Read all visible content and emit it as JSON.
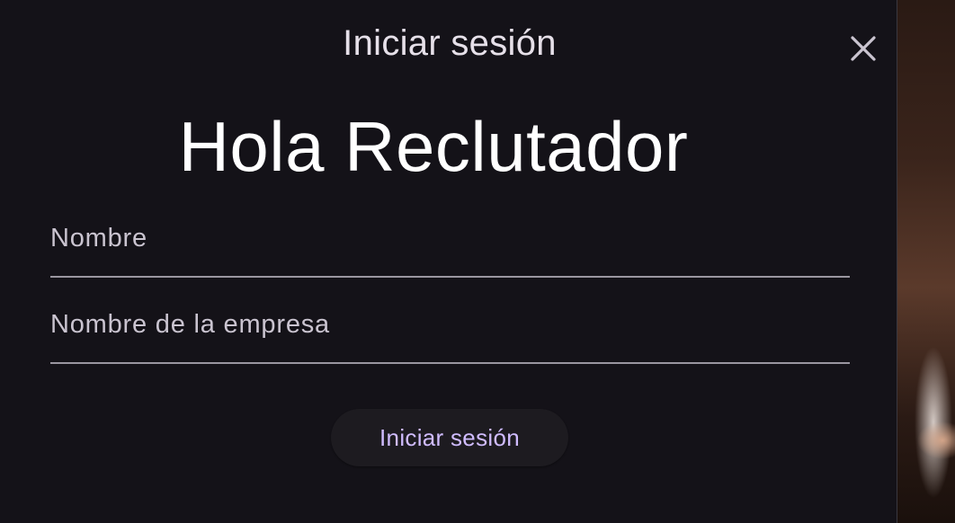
{
  "dialog": {
    "title": "Iniciar sesión",
    "close_icon": "close-icon",
    "greeting": "Hola Reclutador"
  },
  "form": {
    "name_field": {
      "label": "Nombre",
      "value": ""
    },
    "company_field": {
      "label": "Nombre de la empresa",
      "value": ""
    },
    "submit_label": "Iniciar sesión"
  },
  "colors": {
    "surface": "#141218",
    "on_surface": "#e6e0e9",
    "primary": "#d0bcff",
    "outline": "#9a96a0"
  }
}
